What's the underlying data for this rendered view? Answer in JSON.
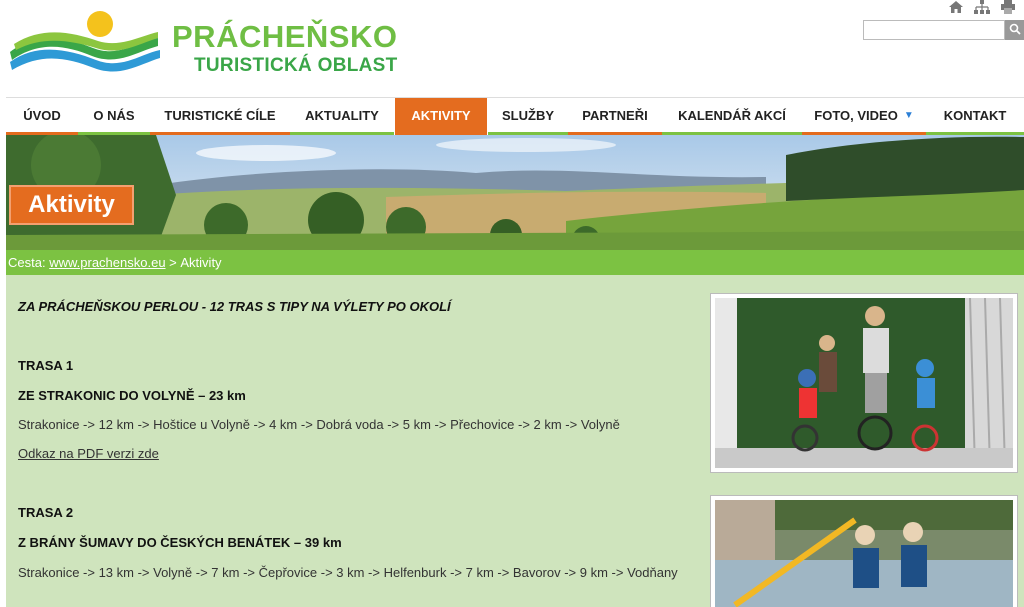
{
  "brand": {
    "title": "PRÁCHEŇSKO",
    "subtitle": "TURISTICKÁ OBLAST",
    "colors": {
      "green": "#6fbe44",
      "dark_green": "#3aa648",
      "orange": "#e46c1f",
      "nav_green": "#7cc242",
      "content_bg": "#cfe4bd"
    }
  },
  "top_icons": [
    "home-icon",
    "sitemap-icon",
    "print-icon"
  ],
  "search": {
    "placeholder": "",
    "value": "",
    "button_icon": "search-icon"
  },
  "nav": {
    "items": [
      {
        "label": "ÚVOD"
      },
      {
        "label": "O NÁS"
      },
      {
        "label": "TURISTICKÉ CÍLE"
      },
      {
        "label": "AKTUALITY"
      },
      {
        "label": "AKTIVITY",
        "active": true
      },
      {
        "label": "SLUŽBY"
      },
      {
        "label": "PARTNEŘI"
      },
      {
        "label": "KALENDÁŘ AKCÍ"
      },
      {
        "label": "FOTO, VIDEO",
        "has_dropdown": true
      },
      {
        "label": "KONTAKT"
      }
    ]
  },
  "banner": {
    "label": "Aktivity"
  },
  "breadcrumb": {
    "prefix": "Cesta:",
    "link": "www.prachensko.eu",
    "separator": ">",
    "current": "Aktivity"
  },
  "content": {
    "intro": "ZA PRÁCHEŇSKOU PERLOU - 12 TRAS S TIPY NA VÝLETY PO OKOLÍ",
    "routes": [
      {
        "heading": "TRASA 1",
        "title": "ZE STRAKONIC DO VOLYNĚ – 23 km",
        "path": "Strakonice -> 12 km -> Hoštice u Volyně -> 4 km -> Dobrá voda -> 5 km -> Přechovice -> 2 km -> Volyně",
        "pdf_link": "Odkaz na PDF verzi zde"
      },
      {
        "heading": "TRASA 2",
        "title": "Z BRÁNY ŠUMAVY DO ČESKÝCH BENÁTEK – 39 km",
        "path": "Strakonice -> 13 km -> Volyně -> 7 km -> Čepřovice -> 3 km -> Helfenburk -> 7 km -> Bavorov -> 9 km -> Vodňany"
      }
    ]
  }
}
